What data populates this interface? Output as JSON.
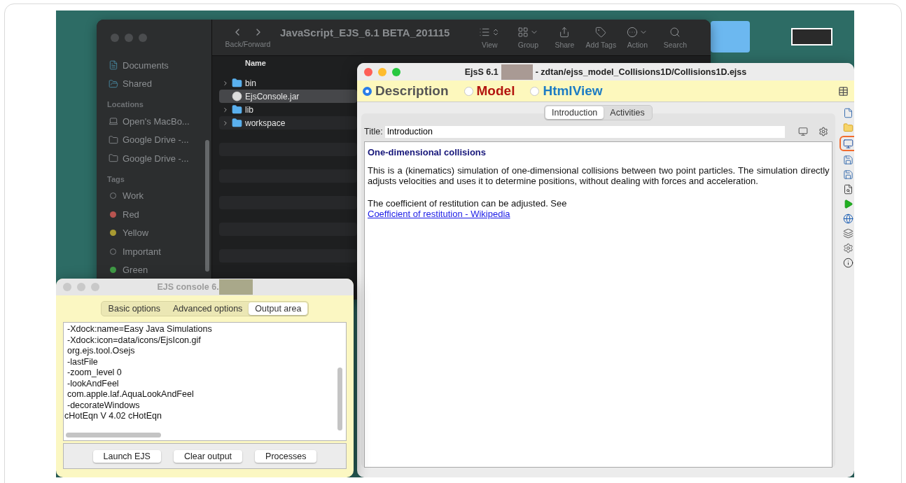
{
  "finder": {
    "toolbar": {
      "nav_label": "Back/Forward",
      "title": "JavaScript_EJS_6.1 BETA_201115",
      "buttons": [
        {
          "kind": "view",
          "label": "View"
        },
        {
          "kind": "group",
          "label": "Group"
        },
        {
          "kind": "share",
          "label": "Share"
        },
        {
          "kind": "tag",
          "label": "Add Tags"
        },
        {
          "kind": "action",
          "label": "Action"
        },
        {
          "kind": "search",
          "label": "Search"
        }
      ]
    },
    "sidebar": [
      {
        "items": [
          {
            "kind": "document",
            "label": "Documents"
          },
          {
            "kind": "shared",
            "label": "Shared"
          }
        ]
      },
      {
        "heading": "Locations",
        "items": [
          {
            "kind": "laptop",
            "label": "Open's MacBo..."
          },
          {
            "kind": "folder",
            "label": "Google Drive -..."
          },
          {
            "kind": "folder",
            "label": "Google Drive -..."
          }
        ]
      },
      {
        "heading": "Tags",
        "items": [
          {
            "kind": "tag",
            "label": "Work"
          },
          {
            "kind": "tag",
            "label": "Red",
            "color": "#b85450"
          },
          {
            "kind": "tag",
            "label": "Yellow",
            "color": "#a89a32"
          },
          {
            "kind": "tag",
            "label": "Important"
          },
          {
            "kind": "tag",
            "label": "Green",
            "color": "#3f9a45"
          }
        ]
      }
    ],
    "columns": [
      "Name"
    ],
    "files": [
      {
        "kind": "folder",
        "name": "bin",
        "selected": false
      },
      {
        "kind": "jar",
        "name": "EjsConsole.jar",
        "selected": true
      },
      {
        "kind": "folder",
        "name": "lib",
        "selected": false
      },
      {
        "kind": "folder",
        "name": "workspace",
        "selected": false
      }
    ]
  },
  "editor": {
    "title_prefix": "EjsS 6.1",
    "title_suffix": "- zdtan/ejss_model_Collisions1D/Collisions1D.ejss",
    "modes": [
      {
        "label": "Description",
        "selected": true,
        "color": "#555555"
      },
      {
        "label": "Model",
        "selected": false,
        "color": "#b3150f"
      },
      {
        "label": "HtmlView",
        "selected": false,
        "color": "#1d7cc4"
      }
    ],
    "tabs": [
      {
        "label": "Introduction",
        "selected": true
      },
      {
        "label": "Activities",
        "selected": false
      }
    ],
    "title_label": "Title:",
    "title_value": "Introduction",
    "heading": "One-dimensional collisions",
    "paragraphs": [
      "This is a (kinematics) simulation of one-dimensional collisions between two point particles. The simulation directly adjusts velocities and uses it to determine positions, without dealing with forces and acceleration.",
      "The coefficient of restitution can be adjusted. See"
    ],
    "link": "Coefficient of restitution - Wikipedia",
    "toolbar": [
      {
        "kind": "new",
        "highlighted": false
      },
      {
        "kind": "open",
        "highlighted": false
      },
      {
        "kind": "monitor",
        "highlighted": true
      },
      {
        "kind": "save",
        "highlighted": false
      },
      {
        "kind": "save",
        "highlighted": false
      },
      {
        "kind": "preview",
        "highlighted": false
      },
      {
        "kind": "run",
        "highlighted": false
      },
      {
        "kind": "globe",
        "highlighted": false
      },
      {
        "kind": "layers",
        "highlighted": false
      },
      {
        "kind": "settings",
        "highlighted": false
      },
      {
        "kind": "info",
        "highlighted": false
      }
    ]
  },
  "console": {
    "title": "EJS console 6.",
    "tabs": [
      {
        "label": "Basic options",
        "selected": false
      },
      {
        "label": "Advanced options",
        "selected": false
      },
      {
        "label": "Output area",
        "selected": true
      }
    ],
    "lines": [
      {
        "text": "-Xdock:name=Easy Java Simulations",
        "indented": true
      },
      {
        "text": "-Xdock:icon=data/icons/EjsIcon.gif",
        "indented": true
      },
      {
        "text": "org.ejs.tool.Osejs",
        "indented": true
      },
      {
        "text": "-lastFile",
        "indented": true
      },
      {
        "text": "-zoom_level 0",
        "indented": true
      },
      {
        "text": "-lookAndFeel",
        "indented": true
      },
      {
        "text": "com.apple.laf.AquaLookAndFeel",
        "indented": true
      },
      {
        "text": "-decorateWindows",
        "indented": true
      },
      {
        "text": "cHotEqn V 4.02 cHotEqn",
        "indented": false
      }
    ],
    "buttons": [
      "Launch EJS",
      "Clear output",
      "Processes"
    ]
  }
}
